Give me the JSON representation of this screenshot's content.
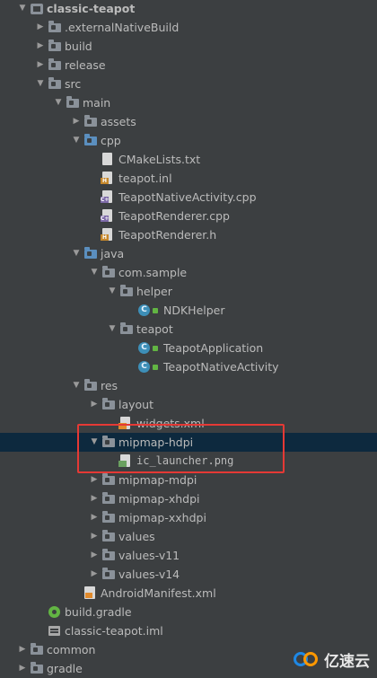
{
  "tree": [
    {
      "label": "classic-teapot",
      "arrow": "down",
      "icon": "module",
      "style": "bold"
    },
    {
      "label": ".externalNativeBuild",
      "arrow": "right",
      "icon": "folder"
    },
    {
      "label": "build",
      "arrow": "right",
      "icon": "folder"
    },
    {
      "label": "release",
      "arrow": "right",
      "icon": "folder"
    },
    {
      "label": "src",
      "arrow": "down",
      "icon": "folder"
    },
    {
      "label": "main",
      "arrow": "down",
      "icon": "folder"
    },
    {
      "label": "assets",
      "arrow": "right",
      "icon": "folder-res"
    },
    {
      "label": "cpp",
      "arrow": "down",
      "icon": "folder-blue"
    },
    {
      "label": "CMakeLists.txt",
      "arrow": "",
      "icon": "file-txt"
    },
    {
      "label": "teapot.inl",
      "arrow": "",
      "icon": "file-inl"
    },
    {
      "label": "TeapotNativeActivity.cpp",
      "arrow": "",
      "icon": "file-cpp"
    },
    {
      "label": "TeapotRenderer.cpp",
      "arrow": "",
      "icon": "file-cpp"
    },
    {
      "label": "TeapotRenderer.h",
      "arrow": "",
      "icon": "file-h"
    },
    {
      "label": "java",
      "arrow": "down",
      "icon": "folder-blue"
    },
    {
      "label": "com.sample",
      "arrow": "down",
      "icon": "folder"
    },
    {
      "label": "helper",
      "arrow": "down",
      "icon": "folder"
    },
    {
      "label": "NDKHelper",
      "arrow": "",
      "icon": "class"
    },
    {
      "label": "teapot",
      "arrow": "down",
      "icon": "folder"
    },
    {
      "label": "TeapotApplication",
      "arrow": "",
      "icon": "class"
    },
    {
      "label": "TeapotNativeActivity",
      "arrow": "",
      "icon": "class"
    },
    {
      "label": "res",
      "arrow": "down",
      "icon": "folder-res"
    },
    {
      "label": "layout",
      "arrow": "right",
      "icon": "folder"
    },
    {
      "label": "widgets.xml",
      "arrow": "",
      "icon": "file-xml"
    },
    {
      "label": "mipmap-hdpi",
      "arrow": "down",
      "icon": "folder",
      "selected": true
    },
    {
      "label": "ic_launcher.png",
      "arrow": "",
      "icon": "file-png"
    },
    {
      "label": "mipmap-mdpi",
      "arrow": "right",
      "icon": "folder"
    },
    {
      "label": "mipmap-xhdpi",
      "arrow": "right",
      "icon": "folder"
    },
    {
      "label": "mipmap-xxhdpi",
      "arrow": "right",
      "icon": "folder"
    },
    {
      "label": "values",
      "arrow": "right",
      "icon": "folder"
    },
    {
      "label": "values-v11",
      "arrow": "right",
      "icon": "folder"
    },
    {
      "label": "values-v14",
      "arrow": "right",
      "icon": "folder"
    },
    {
      "label": "AndroidManifest.xml",
      "arrow": "",
      "icon": "manifest"
    },
    {
      "label": "build.gradle",
      "arrow": "",
      "icon": "gradle"
    },
    {
      "label": "classic-teapot.iml",
      "arrow": "",
      "icon": "iml"
    },
    {
      "label": "common",
      "arrow": "right",
      "icon": "folder"
    },
    {
      "label": "gradle",
      "arrow": "right",
      "icon": "folder"
    }
  ],
  "watermark": {
    "text": "亿速云"
  },
  "colors": {
    "background": "#3c3f41",
    "selection": "#0d293e",
    "highlight_box": "#e53935",
    "text": "#bbbbbb"
  }
}
